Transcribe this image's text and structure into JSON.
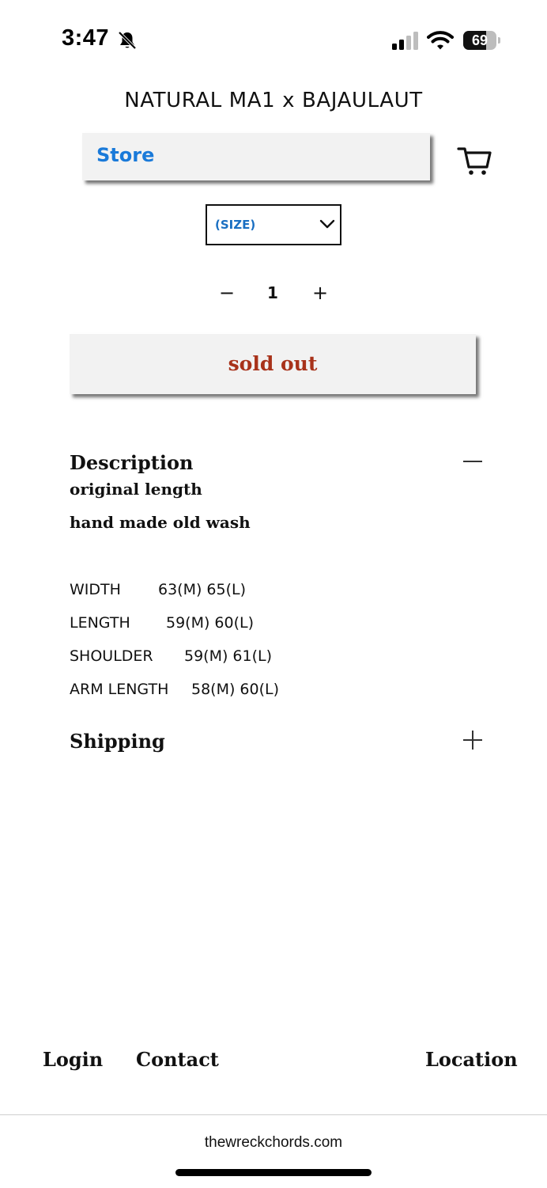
{
  "status_bar": {
    "time": "3:47",
    "battery_level": "69",
    "battery_fraction": 0.69,
    "icons": [
      "bell-slash-icon",
      "cellular-signal-icon",
      "wifi-icon",
      "battery-icon"
    ]
  },
  "header": {
    "title": "NATURAL MA1 x BAJAULAUT",
    "store_label": "Store",
    "cart_icon": "cart-icon"
  },
  "product": {
    "size_select": {
      "selected": "(SIZE)",
      "icon": "chevron-down-icon"
    },
    "quantity": {
      "minus": "−",
      "value": "1",
      "plus": "+"
    },
    "sold_out_label": "sold out"
  },
  "description": {
    "heading": "Description",
    "lines": [
      "original length",
      "hand made old wash"
    ],
    "specs": [
      {
        "name": "WIDTH",
        "value": "63(M) 65(L)"
      },
      {
        "name": "LENGTH",
        "value": "59(M) 60(L)"
      },
      {
        "name": "SHOULDER",
        "value": "59(M) 61(L)"
      },
      {
        "name": "ARM LENGTH",
        "value": "58(M) 60(L)"
      }
    ]
  },
  "shipping": {
    "heading": "Shipping"
  },
  "footer": {
    "login": "Login",
    "contact": "Contact",
    "location": "Location"
  },
  "browser": {
    "url": "thewreckchords.com"
  },
  "colors": {
    "store_text": "#1a7ad9",
    "size_text": "#1a6fc2",
    "sold_out_text": "#a8321a",
    "button_bg": "#f2f2f2"
  }
}
